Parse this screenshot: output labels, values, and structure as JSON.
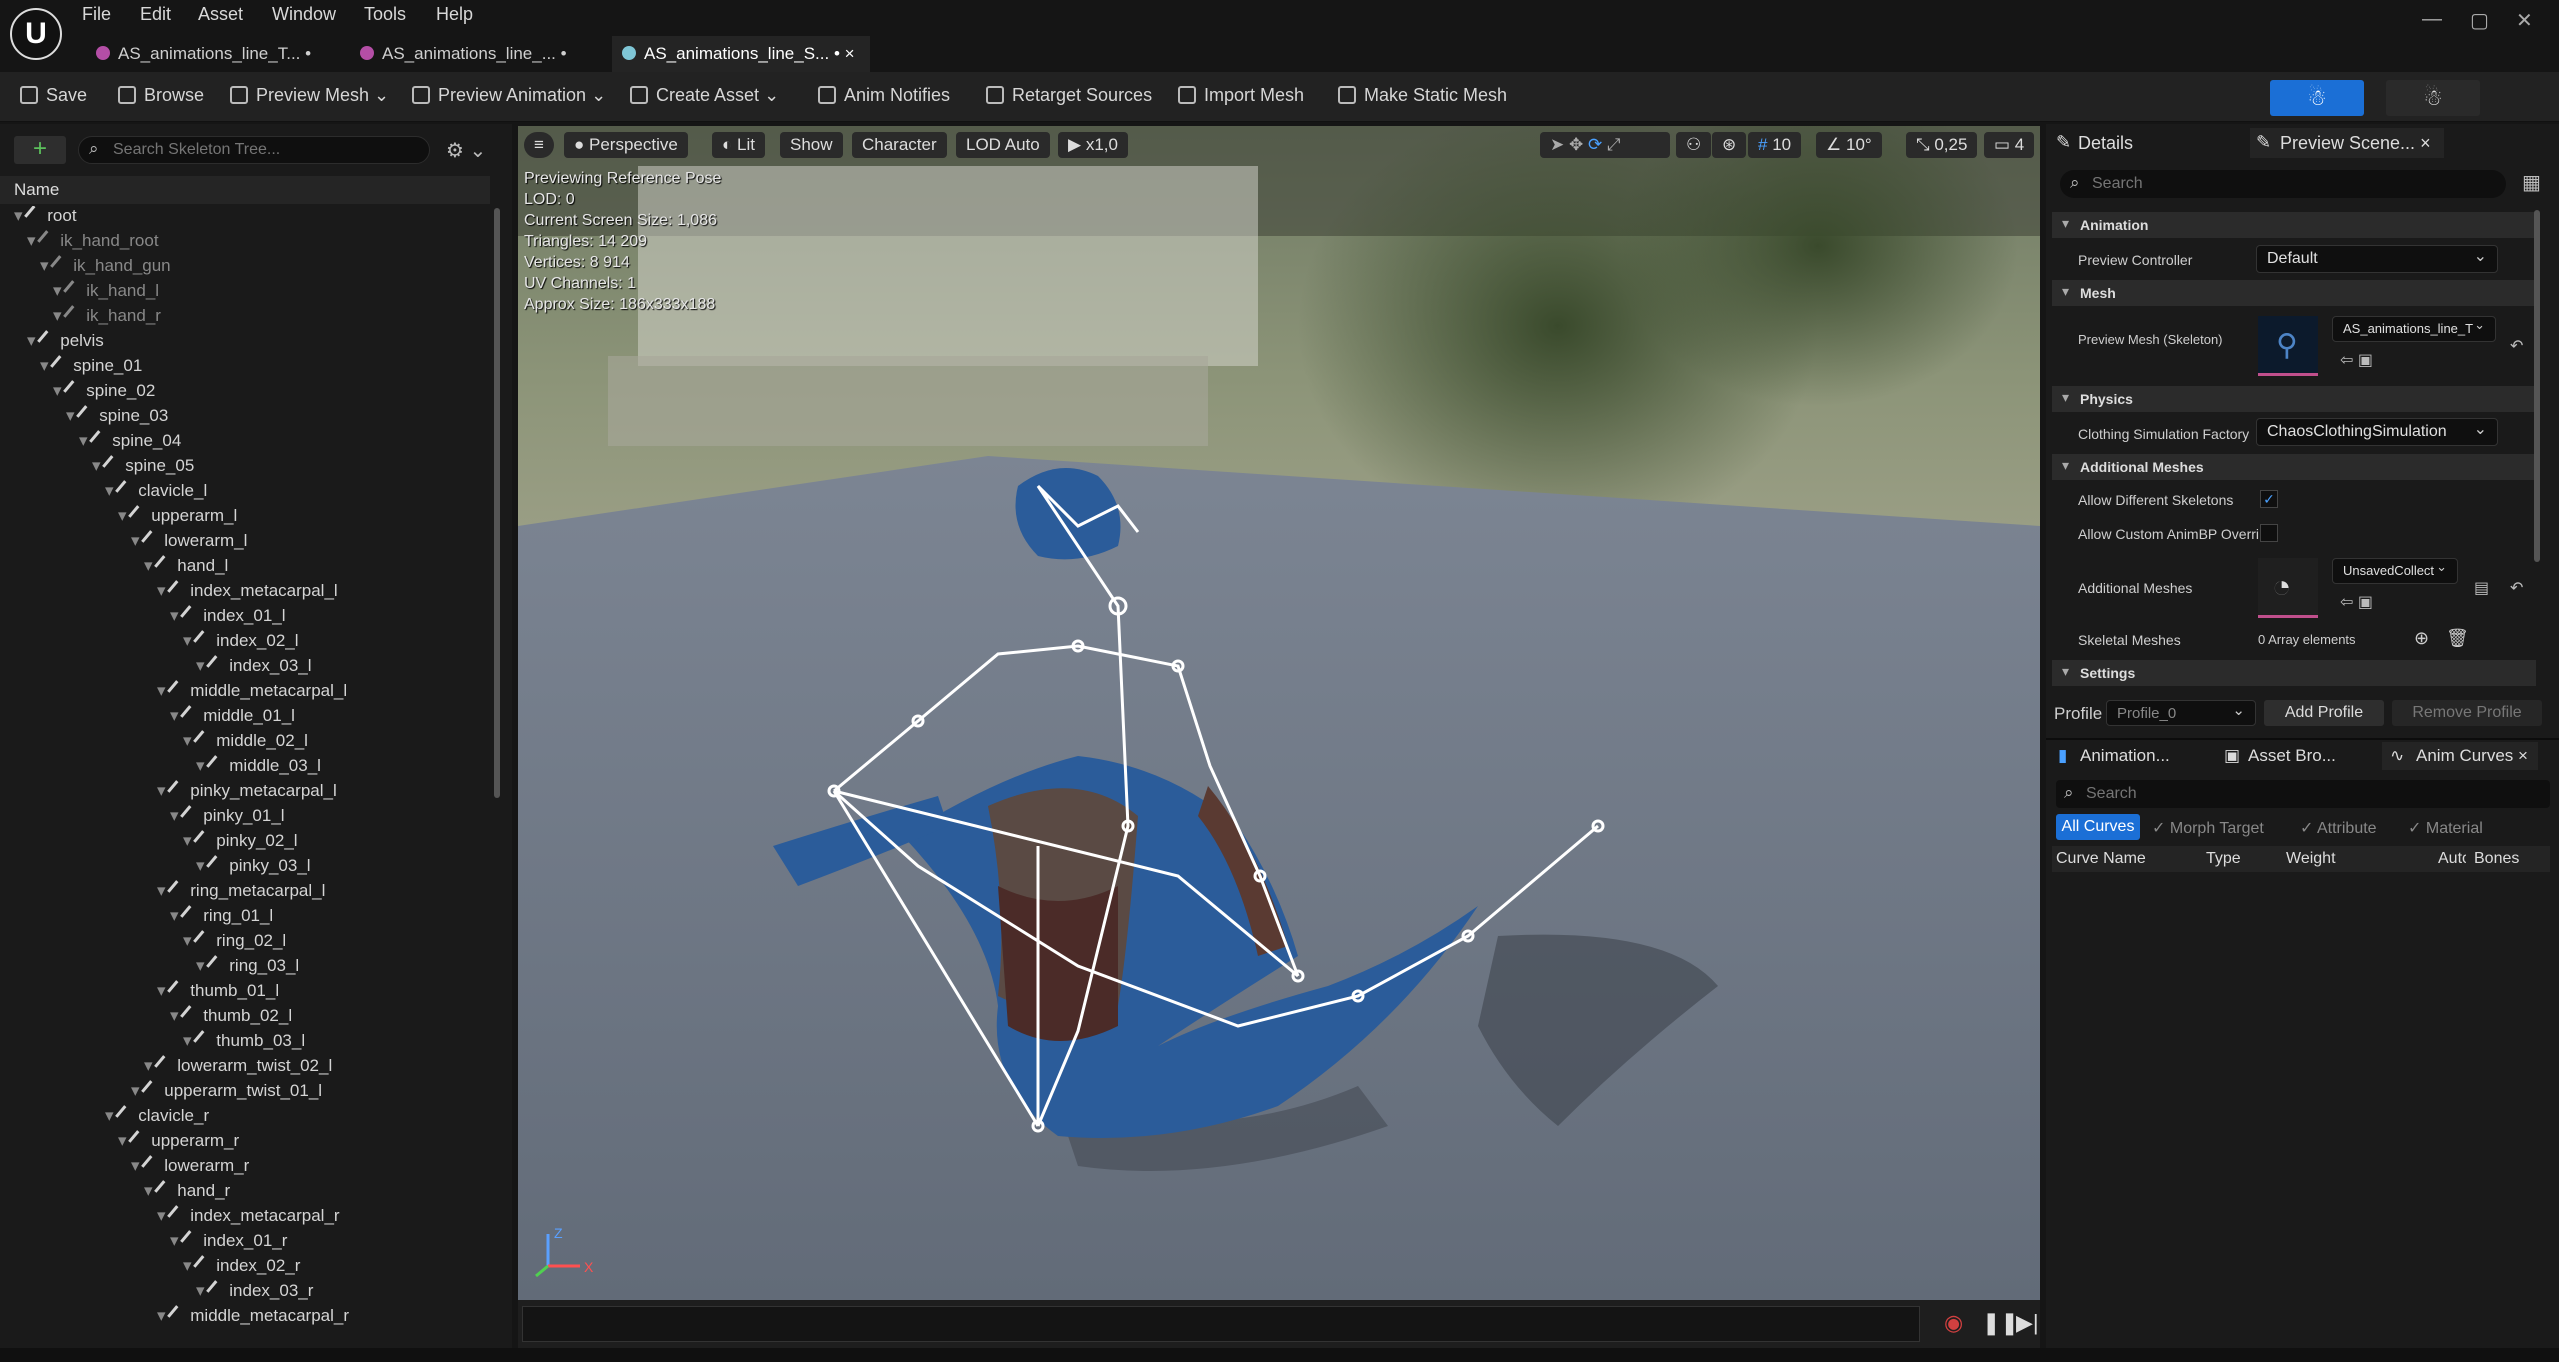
{
  "menu": [
    "File",
    "Edit",
    "Asset",
    "Window",
    "Tools",
    "Help"
  ],
  "tabs": [
    {
      "label": "AS_animations_line_T...",
      "dirty": "•"
    },
    {
      "label": "AS_animations_line_...",
      "dirty": "•"
    },
    {
      "label": "AS_animations_line_S...",
      "dirty": "•"
    }
  ],
  "toolbar": {
    "save": "Save",
    "browse": "Browse",
    "preview_mesh": "Preview Mesh",
    "preview_animation": "Preview Animation",
    "create_asset": "Create Asset",
    "anim_notifies": "Anim Notifies",
    "retarget_sources": "Retarget Sources",
    "import_mesh": "Import Mesh",
    "make_static_mesh": "Make Static Mesh"
  },
  "skeleton": {
    "search_placeholder": "Search Skeleton Tree...",
    "column": "Name",
    "bones": [
      {
        "name": "root",
        "depth": 0,
        "dim": false
      },
      {
        "name": "ik_hand_root",
        "depth": 1,
        "dim": true
      },
      {
        "name": "ik_hand_gun",
        "depth": 2,
        "dim": true
      },
      {
        "name": "ik_hand_l",
        "depth": 3,
        "dim": true
      },
      {
        "name": "ik_hand_r",
        "depth": 3,
        "dim": true
      },
      {
        "name": "pelvis",
        "depth": 1,
        "dim": false
      },
      {
        "name": "spine_01",
        "depth": 2,
        "dim": false
      },
      {
        "name": "spine_02",
        "depth": 3,
        "dim": false
      },
      {
        "name": "spine_03",
        "depth": 4,
        "dim": false
      },
      {
        "name": "spine_04",
        "depth": 5,
        "dim": false
      },
      {
        "name": "spine_05",
        "depth": 6,
        "dim": false
      },
      {
        "name": "clavicle_l",
        "depth": 7,
        "dim": false
      },
      {
        "name": "upperarm_l",
        "depth": 8,
        "dim": false
      },
      {
        "name": "lowerarm_l",
        "depth": 9,
        "dim": false
      },
      {
        "name": "hand_l",
        "depth": 10,
        "dim": false
      },
      {
        "name": "index_metacarpal_l",
        "depth": 11,
        "dim": false
      },
      {
        "name": "index_01_l",
        "depth": 12,
        "dim": false
      },
      {
        "name": "index_02_l",
        "depth": 13,
        "dim": false
      },
      {
        "name": "index_03_l",
        "depth": 14,
        "dim": false
      },
      {
        "name": "middle_metacarpal_l",
        "depth": 11,
        "dim": false
      },
      {
        "name": "middle_01_l",
        "depth": 12,
        "dim": false
      },
      {
        "name": "middle_02_l",
        "depth": 13,
        "dim": false
      },
      {
        "name": "middle_03_l",
        "depth": 14,
        "dim": false
      },
      {
        "name": "pinky_metacarpal_l",
        "depth": 11,
        "dim": false
      },
      {
        "name": "pinky_01_l",
        "depth": 12,
        "dim": false
      },
      {
        "name": "pinky_02_l",
        "depth": 13,
        "dim": false
      },
      {
        "name": "pinky_03_l",
        "depth": 14,
        "dim": false
      },
      {
        "name": "ring_metacarpal_l",
        "depth": 11,
        "dim": false
      },
      {
        "name": "ring_01_l",
        "depth": 12,
        "dim": false
      },
      {
        "name": "ring_02_l",
        "depth": 13,
        "dim": false
      },
      {
        "name": "ring_03_l",
        "depth": 14,
        "dim": false
      },
      {
        "name": "thumb_01_l",
        "depth": 11,
        "dim": false
      },
      {
        "name": "thumb_02_l",
        "depth": 12,
        "dim": false
      },
      {
        "name": "thumb_03_l",
        "depth": 13,
        "dim": false
      },
      {
        "name": "lowerarm_twist_02_l",
        "depth": 10,
        "dim": false
      },
      {
        "name": "upperarm_twist_01_l",
        "depth": 9,
        "dim": false
      },
      {
        "name": "clavicle_r",
        "depth": 7,
        "dim": false
      },
      {
        "name": "upperarm_r",
        "depth": 8,
        "dim": false
      },
      {
        "name": "lowerarm_r",
        "depth": 9,
        "dim": false
      },
      {
        "name": "hand_r",
        "depth": 10,
        "dim": false
      },
      {
        "name": "index_metacarpal_r",
        "depth": 11,
        "dim": false
      },
      {
        "name": "index_01_r",
        "depth": 12,
        "dim": false
      },
      {
        "name": "index_02_r",
        "depth": 13,
        "dim": false
      },
      {
        "name": "index_03_r",
        "depth": 14,
        "dim": false
      },
      {
        "name": "middle_metacarpal_r",
        "depth": 11,
        "dim": false
      }
    ]
  },
  "viewport": {
    "perspective": "Perspective",
    "lit": "Lit",
    "show": "Show",
    "character": "Character",
    "lod": "LOD Auto",
    "speed": "x1,0",
    "grid": "10",
    "angle": "10°",
    "scale": "0,25",
    "cams": "4",
    "stats": [
      "Previewing Reference Pose",
      "LOD: 0",
      "Current Screen Size: 1,086",
      "Triangles: 14 209",
      "Vertices: 8 914",
      "UV Channels: 1",
      "Approx Size: 186x333x188"
    ],
    "axis_z": "Z",
    "axis_x": "X"
  },
  "details": {
    "tab1": "Details",
    "tab2": "Preview Scene...",
    "search_placeholder": "Search",
    "sections": {
      "animation": "Animation",
      "mesh": "Mesh",
      "physics": "Physics",
      "additional": "Additional Meshes",
      "settings": "Settings"
    },
    "preview_controller_label": "Preview Controller",
    "preview_controller_value": "Default",
    "preview_mesh_label": "Preview Mesh (Skeleton)",
    "preview_mesh_value": "AS_animations_line_T",
    "clothing_label": "Clothing Simulation Factory",
    "clothing_value": "ChaosClothingSimulation",
    "allow_diff_label": "Allow Different Skeletons",
    "allow_custom_label": "Allow Custom AnimBP Overri",
    "additional_label": "Additional Meshes",
    "additional_value": "UnsavedCollect",
    "skeletal_label": "Skeletal Meshes",
    "skeletal_value": "0 Array elements",
    "profile_label": "Profile",
    "profile_value": "Profile_0",
    "add_profile": "Add Profile",
    "remove_profile": "Remove Profile"
  },
  "bottom": {
    "tab1": "Animation...",
    "tab2": "Asset Bro...",
    "tab3": "Anim Curves",
    "search_placeholder": "Search",
    "filters": [
      "All Curves",
      "Morph Target",
      "Attribute",
      "Material"
    ],
    "columns": [
      "Curve Name",
      "Type",
      "Weight",
      "Auto",
      "Bones"
    ]
  },
  "colors": {
    "accent": "#1b6fd6",
    "mesh": "#2b5c9a"
  }
}
